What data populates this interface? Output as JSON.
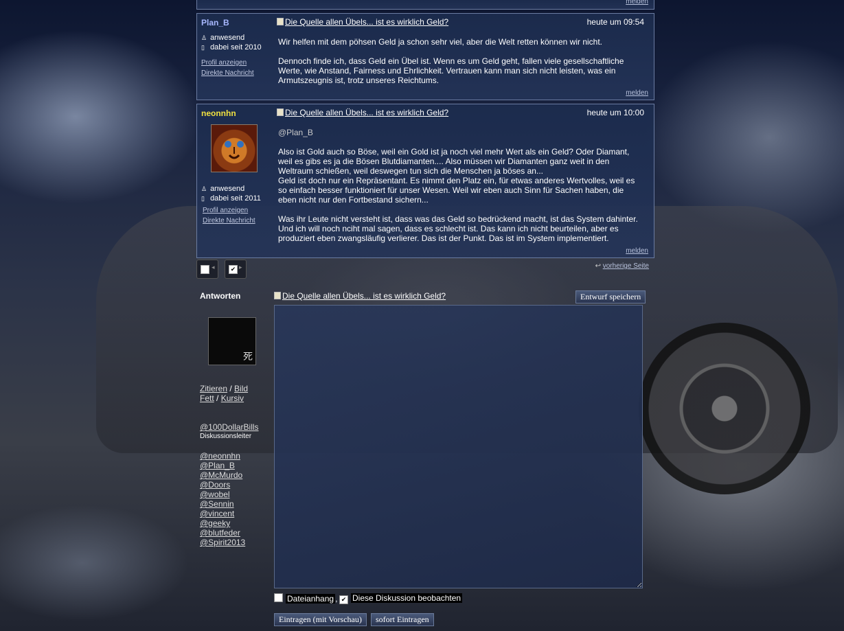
{
  "colors": {
    "username_blue": "#a8b8ff",
    "username_yellow": "#f0e040",
    "panel": "#1c2c4e"
  },
  "top_strip": {
    "report_label": "melden"
  },
  "posts": [
    {
      "username": "Plan_B",
      "status": "anwesend",
      "since": "dabei seit 2010",
      "profile_label": "Profil anzeigen",
      "message_label": "Direkte Nachricht",
      "title": "Die Quelle allen Übels... ist es wirklich Geld?",
      "time": "heute um 09:54",
      "paragraphs": [
        "Wir helfen mit dem pöhsen Geld ja schon sehr viel, aber die Welt retten können wir nicht.",
        "Dennoch finde ich, dass Geld ein Übel ist. Wenn es um Geld geht, fallen viele gesellschaftliche Werte, wie Anstand, Fairness und Ehrlichkeit. Vertrauen kann man sich nicht leisten, was ein Armutszeugnis ist, trotz unseres Reichtums."
      ],
      "report_label": "melden"
    },
    {
      "username": "neonnhn",
      "status": "anwesend",
      "since": "dabei seit 2011",
      "profile_label": "Profil anzeigen",
      "message_label": "Direkte Nachricht",
      "title": "Die Quelle allen Übels... ist es wirklich Geld?",
      "time": "heute um 10:00",
      "paragraphs": [
        "@Plan_B",
        "Also ist Gold auch so Böse, weil ein Gold ist ja noch viel mehr Wert als ein Geld? Oder Diamant, weil es gibs es ja die Bösen Blutdiamanten.... Also müssen wir Diamanten ganz weit in den Weltraum schießen, weil deswegen tun sich die Menschen ja böses an...",
        "Geld ist doch nur ein Repräsentant. Es nimmt den Platz ein, für etwas anderes Wertvolles, weil es so einfach besser funktioniert für unser Wesen. Weil wir eben auch Sinn für Sachen haben, die eben nicht nur den Fortbestand sichern...",
        "Was ihr Leute nicht versteht ist, dass was das Geld so bedrückend macht, ist das System dahinter. Und ich will noch nciht mal sagen, dass es schlecht ist. Das kann ich nicht beurteilen, aber es produziert eben zwangsläufig verlierer. Das ist der Punkt. Das ist im System implementiert."
      ],
      "report_label": "melden"
    }
  ],
  "pagination": {
    "prev_label": "vorherige Seite"
  },
  "reply": {
    "heading": "Antworten",
    "avatar_glyph": "死",
    "title": "Die Quelle allen Übels... ist es wirklich Geld?",
    "draft_button": "Entwurf speichern",
    "format": {
      "quote": "Zitieren",
      "image": "Bild",
      "bold": "Fett",
      "italic": "Kursiv",
      "sep": "/"
    },
    "leader": {
      "name": "@100DollarBills",
      "role": "Diskussionsleiter"
    },
    "mentions": [
      "@neonnhn",
      "@Plan_B",
      "@McMurdo",
      "@Doors",
      "@wobel",
      "@Sennin",
      "@vincent",
      "@geeky",
      "@blutfeder",
      "@Spirit2013"
    ],
    "attach_label": "Dateianhang",
    "comma": ",",
    "watch_label": "Diese Diskussion beobachten",
    "submit_preview": "Eintragen (mit Vorschau)",
    "submit_now": "sofort Eintragen"
  }
}
